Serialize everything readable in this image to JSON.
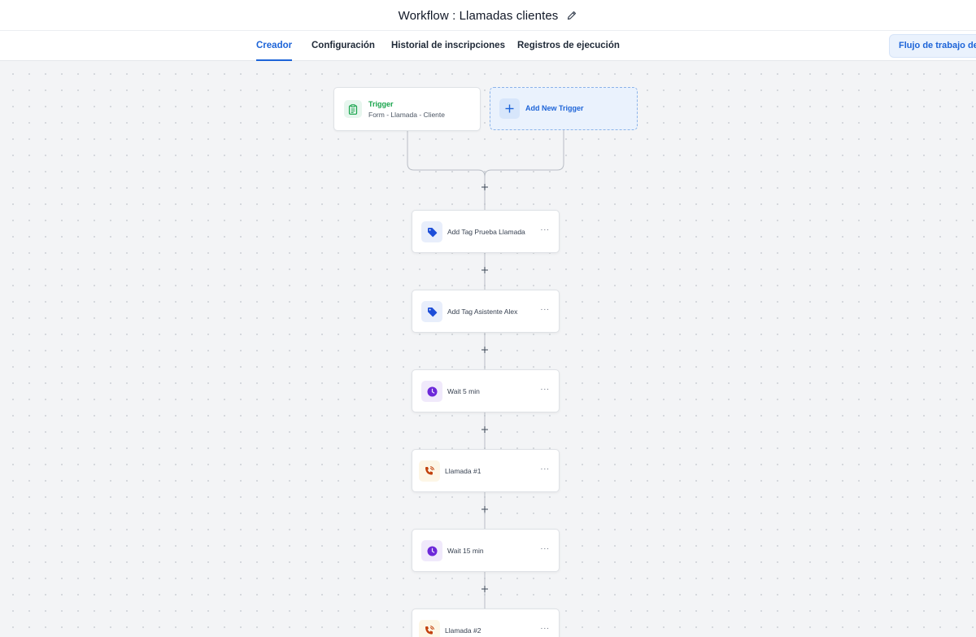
{
  "header": {
    "title": "Workflow : Llamadas clientes",
    "edit_icon": "pencil-icon"
  },
  "tabs": [
    {
      "label": "Creador",
      "active": true
    },
    {
      "label": "Configuración",
      "active": false
    },
    {
      "label": "Historial de inscripciones",
      "active": false
    },
    {
      "label": "Registros de ejecución",
      "active": false
    }
  ],
  "flow_button": {
    "label": "Flujo de trabajo de p"
  },
  "trigger": {
    "title": "Trigger",
    "subtitle": "Form - Llamada - Cliente",
    "icon": "clipboard-icon"
  },
  "add_trigger": {
    "label": "Add New Trigger",
    "icon": "plus-icon"
  },
  "actions": [
    {
      "label": "Add Tag Prueba Llamada",
      "type": "tag",
      "icon": "tag-icon",
      "more": "···"
    },
    {
      "label": "Add Tag Asistente Alex",
      "type": "tag",
      "icon": "tag-icon",
      "more": "···"
    },
    {
      "label": "Wait 5 min",
      "type": "wait",
      "icon": "clock-icon",
      "more": "···"
    },
    {
      "label": "Llamada #1",
      "type": "call",
      "icon": "phone-ringing-icon",
      "more": "···"
    },
    {
      "label": "Wait 15 min",
      "type": "wait",
      "icon": "clock-icon",
      "more": "···"
    },
    {
      "label": "Llamada #2",
      "type": "call",
      "icon": "phone-ringing-icon",
      "more": "···"
    }
  ],
  "colors": {
    "accent": "#1d64d8",
    "trigger_green": "#16a34a",
    "tag_blue": "#1d4ed8",
    "wait_purple": "#6d28d9",
    "call_orange": "#c2410c",
    "canvas_bg": "#f3f4f6"
  }
}
